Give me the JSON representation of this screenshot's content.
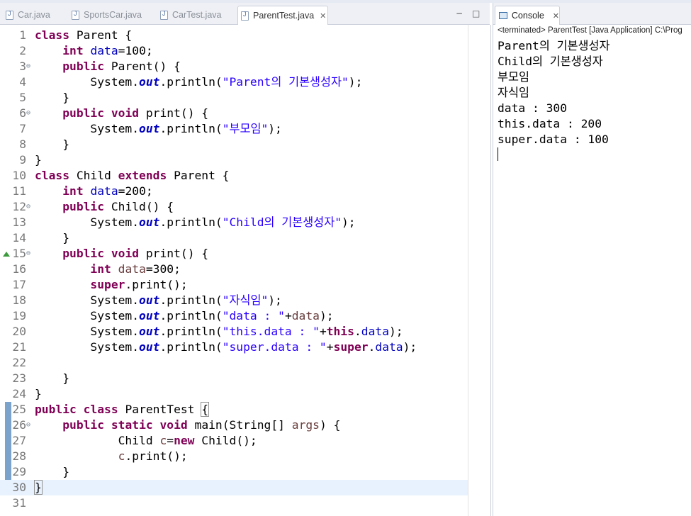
{
  "tabs": [
    {
      "label": "Car.java",
      "active": false
    },
    {
      "label": "SportsCar.java",
      "active": false
    },
    {
      "label": "CarTest.java",
      "active": false
    },
    {
      "label": "ParentTest.java",
      "active": true
    }
  ],
  "editor": {
    "window_controls": {
      "minimize": "−",
      "maximize": "□"
    },
    "lines": [
      {
        "num": "1",
        "fold": "",
        "segs": [
          [
            "k",
            "class"
          ],
          [
            "t",
            " Parent {"
          ]
        ]
      },
      {
        "num": "2",
        "fold": "",
        "segs": [
          [
            "t",
            "    "
          ],
          [
            "k",
            "int"
          ],
          [
            "t",
            " "
          ],
          [
            "f",
            "data"
          ],
          [
            "t",
            "=100;"
          ]
        ]
      },
      {
        "num": "3",
        "fold": "⊖",
        "segs": [
          [
            "t",
            "    "
          ],
          [
            "k",
            "public"
          ],
          [
            "t",
            " Parent() {"
          ]
        ]
      },
      {
        "num": "4",
        "fold": "",
        "segs": [
          [
            "t",
            "        System."
          ],
          [
            "sf",
            "out"
          ],
          [
            "t",
            ".println("
          ],
          [
            "s",
            "\"Parent의 기본생성자\""
          ],
          [
            "t",
            ");"
          ]
        ]
      },
      {
        "num": "5",
        "fold": "",
        "segs": [
          [
            "t",
            "    }"
          ]
        ]
      },
      {
        "num": "6",
        "fold": "⊖",
        "segs": [
          [
            "t",
            "    "
          ],
          [
            "k",
            "public"
          ],
          [
            "t",
            " "
          ],
          [
            "k",
            "void"
          ],
          [
            "t",
            " print() {"
          ]
        ]
      },
      {
        "num": "7",
        "fold": "",
        "segs": [
          [
            "t",
            "        System."
          ],
          [
            "sf",
            "out"
          ],
          [
            "t",
            ".println("
          ],
          [
            "s",
            "\"부모임\""
          ],
          [
            "t",
            ");"
          ]
        ]
      },
      {
        "num": "8",
        "fold": "",
        "segs": [
          [
            "t",
            "    }"
          ]
        ]
      },
      {
        "num": "9",
        "fold": "",
        "segs": [
          [
            "t",
            "}"
          ]
        ]
      },
      {
        "num": "10",
        "fold": "",
        "segs": [
          [
            "k",
            "class"
          ],
          [
            "t",
            " Child "
          ],
          [
            "k",
            "extends"
          ],
          [
            "t",
            " Parent {"
          ]
        ]
      },
      {
        "num": "11",
        "fold": "",
        "segs": [
          [
            "t",
            "    "
          ],
          [
            "k",
            "int"
          ],
          [
            "t",
            " "
          ],
          [
            "f",
            "data"
          ],
          [
            "t",
            "=200;"
          ]
        ]
      },
      {
        "num": "12",
        "fold": "⊖",
        "segs": [
          [
            "t",
            "    "
          ],
          [
            "k",
            "public"
          ],
          [
            "t",
            " Child() {"
          ]
        ]
      },
      {
        "num": "13",
        "fold": "",
        "segs": [
          [
            "t",
            "        System."
          ],
          [
            "sf",
            "out"
          ],
          [
            "t",
            ".println("
          ],
          [
            "s",
            "\"Child의 기본생성자\""
          ],
          [
            "t",
            ");"
          ]
        ]
      },
      {
        "num": "14",
        "fold": "",
        "segs": [
          [
            "t",
            "    }"
          ]
        ]
      },
      {
        "num": "15",
        "fold": "⊖",
        "override": true,
        "segs": [
          [
            "t",
            "    "
          ],
          [
            "k",
            "public"
          ],
          [
            "t",
            " "
          ],
          [
            "k",
            "void"
          ],
          [
            "t",
            " print() {"
          ]
        ]
      },
      {
        "num": "16",
        "fold": "",
        "segs": [
          [
            "t",
            "        "
          ],
          [
            "k",
            "int"
          ],
          [
            "t",
            " "
          ],
          [
            "l",
            "data"
          ],
          [
            "t",
            "=300;"
          ]
        ]
      },
      {
        "num": "17",
        "fold": "",
        "segs": [
          [
            "t",
            "        "
          ],
          [
            "k",
            "super"
          ],
          [
            "t",
            ".print();"
          ]
        ]
      },
      {
        "num": "18",
        "fold": "",
        "segs": [
          [
            "t",
            "        System."
          ],
          [
            "sf",
            "out"
          ],
          [
            "t",
            ".println("
          ],
          [
            "s",
            "\"자식임\""
          ],
          [
            "t",
            ");"
          ]
        ]
      },
      {
        "num": "19",
        "fold": "",
        "segs": [
          [
            "t",
            "        System."
          ],
          [
            "sf",
            "out"
          ],
          [
            "t",
            ".println("
          ],
          [
            "s",
            "\"data : \""
          ],
          [
            "t",
            "+"
          ],
          [
            "l",
            "data"
          ],
          [
            "t",
            ");"
          ]
        ]
      },
      {
        "num": "20",
        "fold": "",
        "segs": [
          [
            "t",
            "        System."
          ],
          [
            "sf",
            "out"
          ],
          [
            "t",
            ".println("
          ],
          [
            "s",
            "\"this.data : \""
          ],
          [
            "t",
            "+"
          ],
          [
            "k",
            "this"
          ],
          [
            "t",
            "."
          ],
          [
            "f",
            "data"
          ],
          [
            "t",
            ");"
          ]
        ]
      },
      {
        "num": "21",
        "fold": "",
        "segs": [
          [
            "t",
            "        System."
          ],
          [
            "sf",
            "out"
          ],
          [
            "t",
            ".println("
          ],
          [
            "s",
            "\"super.data : \""
          ],
          [
            "t",
            "+"
          ],
          [
            "k",
            "super"
          ],
          [
            "t",
            "."
          ],
          [
            "f",
            "data"
          ],
          [
            "t",
            ");"
          ]
        ]
      },
      {
        "num": "22",
        "fold": "",
        "segs": []
      },
      {
        "num": "23",
        "fold": "",
        "segs": [
          [
            "t",
            "    }"
          ]
        ]
      },
      {
        "num": "24",
        "fold": "",
        "segs": [
          [
            "t",
            "}"
          ]
        ]
      },
      {
        "num": "25",
        "fold": "",
        "segs": [
          [
            "k",
            "public"
          ],
          [
            "t",
            " "
          ],
          [
            "k",
            "class"
          ],
          [
            "t",
            " ParentTest "
          ],
          [
            "b",
            "{"
          ]
        ]
      },
      {
        "num": "26",
        "fold": "⊖",
        "segs": [
          [
            "t",
            "    "
          ],
          [
            "k",
            "public"
          ],
          [
            "t",
            " "
          ],
          [
            "k",
            "static"
          ],
          [
            "t",
            " "
          ],
          [
            "k",
            "void"
          ],
          [
            "t",
            " main(String[] "
          ],
          [
            "l",
            "args"
          ],
          [
            "t",
            ") {"
          ]
        ]
      },
      {
        "num": "27",
        "fold": "",
        "segs": [
          [
            "t",
            "            Child "
          ],
          [
            "l",
            "c"
          ],
          [
            "t",
            "="
          ],
          [
            "k",
            "new"
          ],
          [
            "t",
            " Child();"
          ]
        ]
      },
      {
        "num": "28",
        "fold": "",
        "segs": [
          [
            "t",
            "            "
          ],
          [
            "l",
            "c"
          ],
          [
            "t",
            ".print();"
          ]
        ]
      },
      {
        "num": "29",
        "fold": "",
        "segs": [
          [
            "t",
            "    }"
          ]
        ]
      },
      {
        "num": "30",
        "fold": "",
        "current": true,
        "segs": [
          [
            "b",
            "}"
          ]
        ]
      },
      {
        "num": "31",
        "fold": "",
        "segs": []
      }
    ]
  },
  "console": {
    "tab_label": "Console",
    "status": "<terminated> ParentTest [Java Application] C:\\Prog",
    "output": [
      "Parent의 기본생성자",
      "Child의 기본생성자",
      "부모임",
      "자식임",
      "data : 300",
      "this.data : 200",
      "super.data : 100"
    ]
  },
  "colors": {
    "keyword": "#7f0055",
    "string": "#2a00ff",
    "field": "#0000c0",
    "local": "#6a3e3e",
    "current_line": "#e8f2fe"
  }
}
